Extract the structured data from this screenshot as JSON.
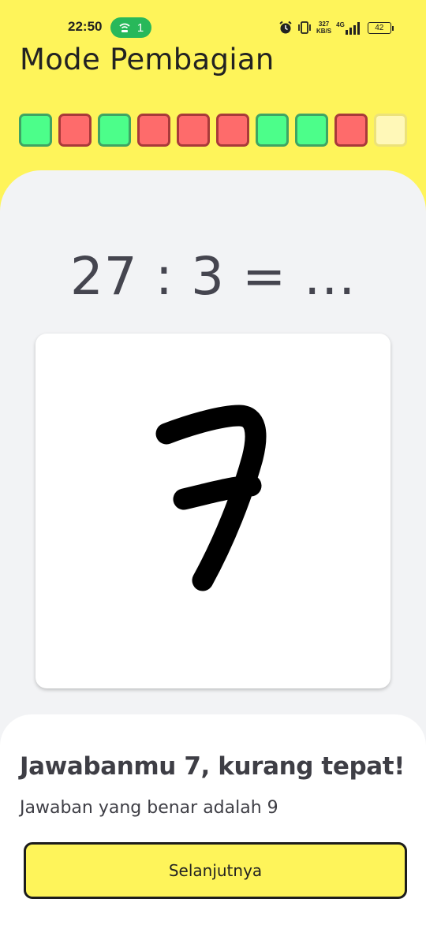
{
  "status_bar": {
    "time": "22:50",
    "hotspot_count": "1",
    "net_speed_value": "327",
    "net_speed_unit": "KB/S",
    "network_type": "4G",
    "battery": "42"
  },
  "header": {
    "title": "Mode Pembagian"
  },
  "progress": {
    "items": [
      {
        "state": "correct"
      },
      {
        "state": "wrong"
      },
      {
        "state": "correct"
      },
      {
        "state": "wrong"
      },
      {
        "state": "wrong"
      },
      {
        "state": "wrong"
      },
      {
        "state": "correct"
      },
      {
        "state": "correct"
      },
      {
        "state": "wrong"
      },
      {
        "state": "pending"
      }
    ]
  },
  "question": {
    "text": "27 : 3 = ..."
  },
  "drawing": {
    "stroke_color": "#000000"
  },
  "feedback": {
    "title": "Jawabanmu 7, kurang tepat!",
    "message": "Jawaban yang benar adalah 9",
    "next_label": "Selanjutnya"
  },
  "colors": {
    "accent": "#fef45a",
    "correct": "#4cfe8a",
    "wrong": "#fe6b6b",
    "pending": "#fff8b8"
  }
}
